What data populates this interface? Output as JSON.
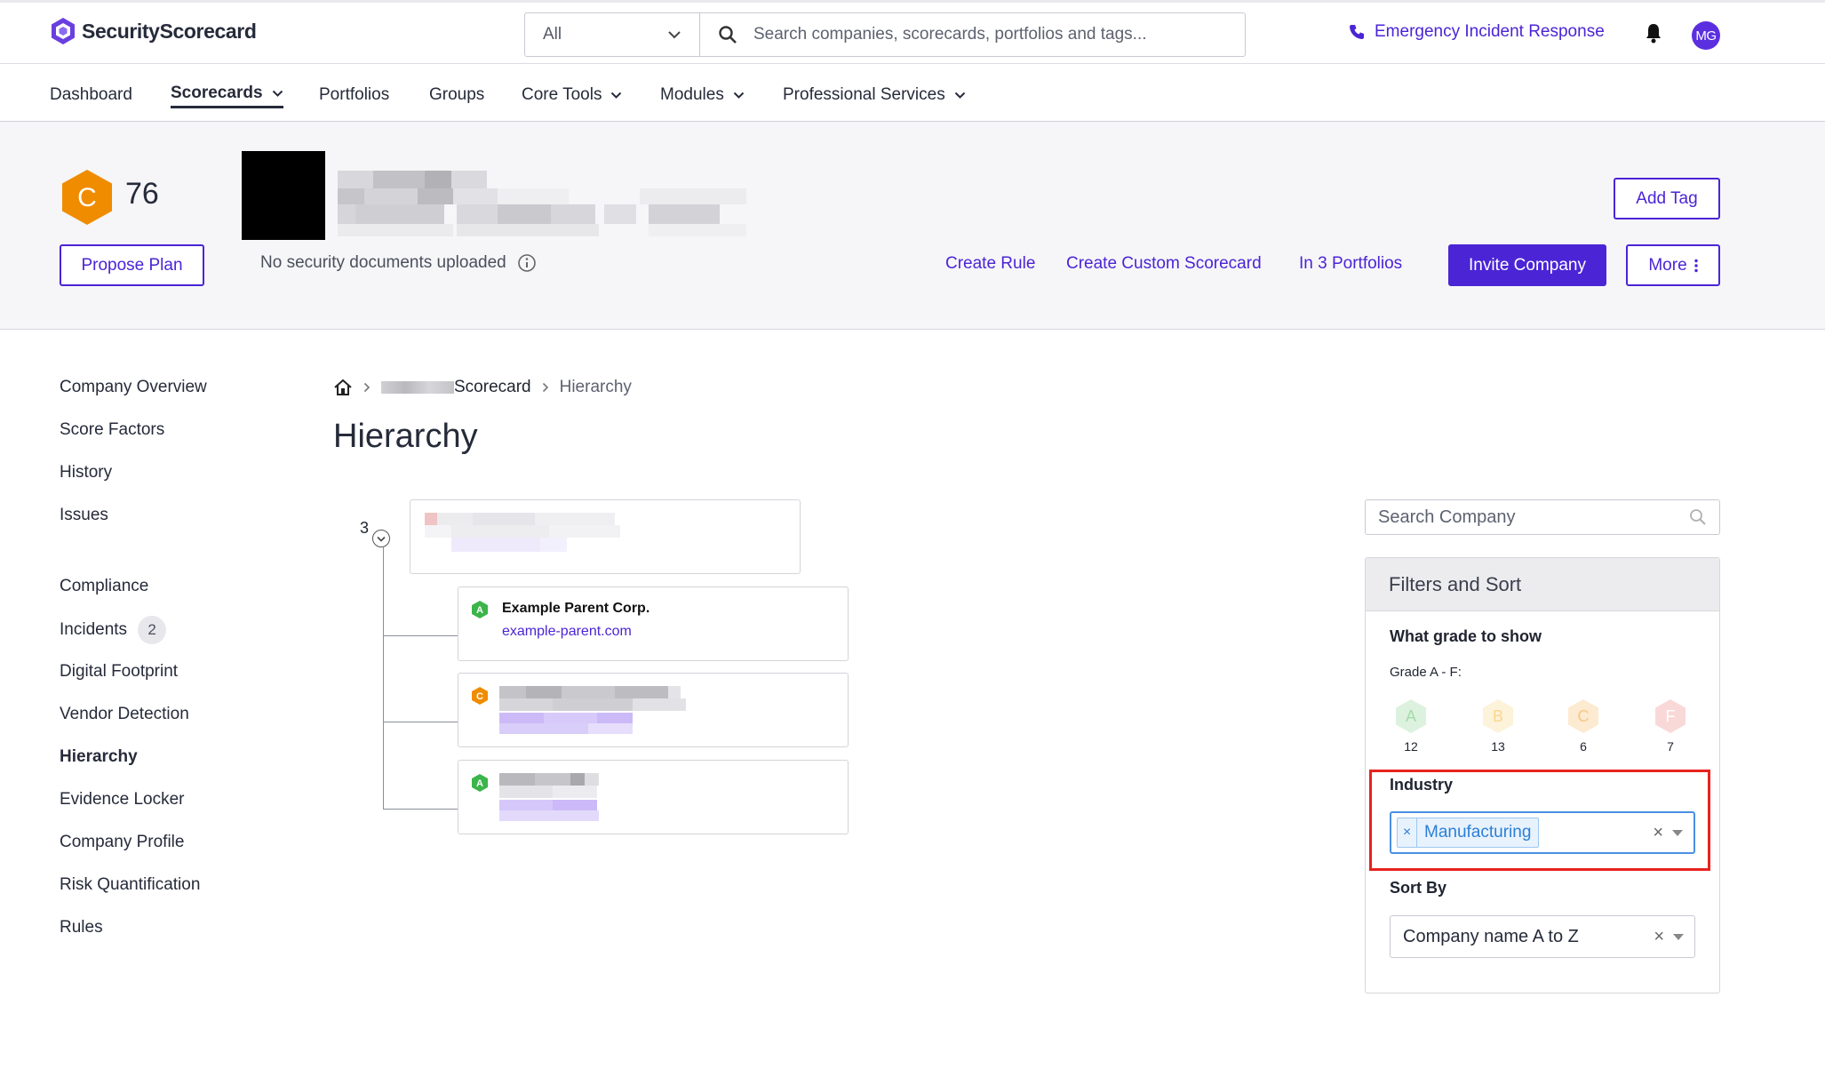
{
  "header": {
    "brand": "SecurityScorecard",
    "scope_value": "All",
    "search_placeholder": "Search companies, scorecards, portfolios and tags...",
    "emergency_label": "Emergency Incident Response",
    "avatar_initials": "MG"
  },
  "nav": {
    "dashboard": "Dashboard",
    "scorecards": "Scorecards",
    "portfolios": "Portfolios",
    "groups": "Groups",
    "core_tools": "Core Tools",
    "modules": "Modules",
    "professional_services": "Professional Services"
  },
  "company": {
    "grade": "C",
    "score": "76",
    "grade_color": "#f08c00",
    "propose_plan": "Propose Plan",
    "docs_status": "No security documents uploaded",
    "add_tag": "Add Tag",
    "create_rule": "Create Rule",
    "create_custom_scorecard": "Create Custom Scorecard",
    "in_portfolios": "In 3 Portfolios",
    "invite_company": "Invite Company",
    "more": "More"
  },
  "sidebar": {
    "company_overview": "Company Overview",
    "score_factors": "Score Factors",
    "history": "History",
    "issues": "Issues",
    "compliance": "Compliance",
    "incidents": "Incidents",
    "incidents_count": "2",
    "digital_footprint": "Digital Footprint",
    "vendor_detection": "Vendor Detection",
    "hierarchy": "Hierarchy",
    "evidence_locker": "Evidence Locker",
    "company_profile": "Company Profile",
    "risk_quantification": "Risk Quantification",
    "rules": "Rules"
  },
  "breadcrumb": {
    "scorecard": "Scorecard",
    "current": "Hierarchy"
  },
  "page": {
    "title": "Hierarchy"
  },
  "tree": {
    "child_count": "3",
    "children": [
      {
        "grade": "A",
        "grade_color": "#3bb54a",
        "name": "Example Parent Corp.",
        "domain": "example-parent.com"
      },
      {
        "grade": "C",
        "grade_color": "#f08c00",
        "name": "",
        "domain": ""
      },
      {
        "grade": "A",
        "grade_color": "#3bb54a",
        "name": "",
        "domain": ""
      }
    ]
  },
  "filters": {
    "search_placeholder": "Search Company",
    "panel_title": "Filters and Sort",
    "grade_label": "What grade to show",
    "grade_sub": "Grade A - F:",
    "grades": [
      {
        "grade": "A",
        "count": "12",
        "color": "#3bb54a"
      },
      {
        "grade": "B",
        "count": "13",
        "color": "#f5b731"
      },
      {
        "grade": "C",
        "count": "6",
        "color": "#f08c00"
      },
      {
        "grade": "F",
        "count": "7",
        "color": "#e0423d"
      }
    ],
    "industry_label": "Industry",
    "industry_value": "Manufacturing",
    "sort_label": "Sort By",
    "sort_value": "Company name A to Z"
  }
}
